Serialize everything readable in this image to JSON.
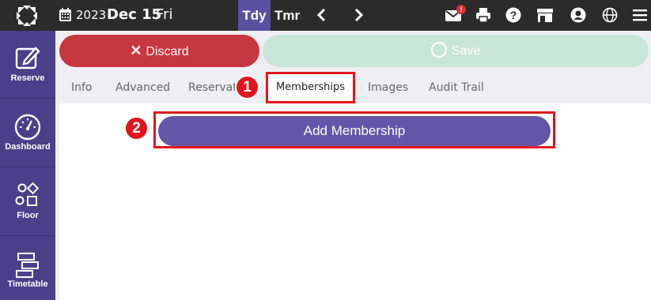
{
  "topbar": {
    "year": "2023",
    "month_day": "Dec 15",
    "weekday": "Fri",
    "today_label": "Tdy",
    "tomorrow_label": "Tmr",
    "mail_badge": "!"
  },
  "sidebar": {
    "items": [
      {
        "label": "Reserve",
        "icon": "edit-icon"
      },
      {
        "label": "Dashboard",
        "icon": "gauge-icon"
      },
      {
        "label": "Floor",
        "icon": "shapes-icon"
      },
      {
        "label": "Timetable",
        "icon": "timetable-icon"
      }
    ]
  },
  "actions": {
    "discard_label": "Discard",
    "save_label": "Save"
  },
  "tabs": [
    "Info",
    "Advanced",
    "Reservat",
    "Memberships",
    "Images",
    "Audit Trail"
  ],
  "active_tab": "Memberships",
  "content": {
    "add_button_label": "Add Membership"
  },
  "annotations": [
    "1",
    "2"
  ],
  "colors": {
    "topbar": "#2b2b2b",
    "sidebar": "#4b3f8a",
    "accent": "#6356a8",
    "discard": "#c9373e",
    "save_disabled": "#c8e6d7",
    "highlight": "#e0141e"
  }
}
